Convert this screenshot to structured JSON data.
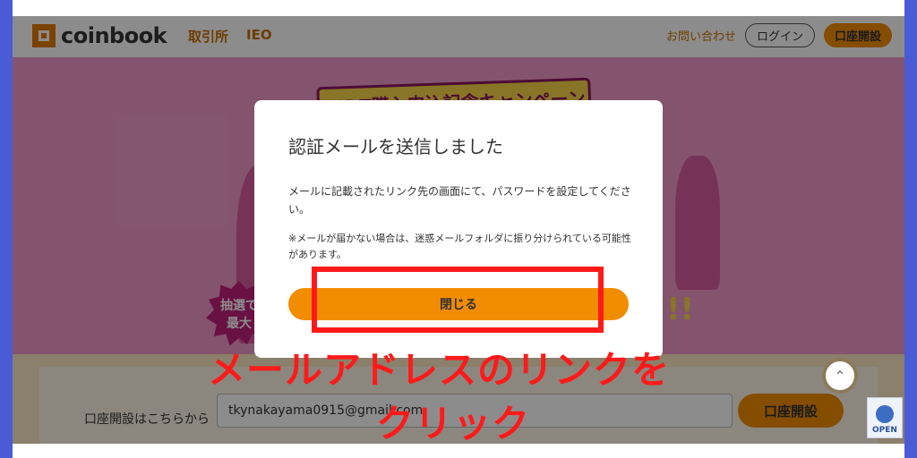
{
  "header": {
    "logo_text": "coinbook",
    "nav": [
      "取引所",
      "IEO"
    ],
    "contact_label": "お問い合わせ",
    "login_label": "ログイン",
    "open_account_label": "口座開設"
  },
  "hero": {
    "campaign_title": "NIDT購入申込記念キャンペーン",
    "burst_line1": "抽選で",
    "burst_line2": "最大",
    "exclaim": "!!"
  },
  "signup": {
    "label": "口座開設はこちらから",
    "email_value": "tkynakayama0915@gmail.com",
    "button_label": "口座開設"
  },
  "badge": {
    "text": "OPEN"
  },
  "modal": {
    "title": "認証メールを送信しました",
    "body": "メールに記載されたリンク先の画面にて、パスワードを設定してください。",
    "note": "※メールが届かない場合は、迷惑メールフォルダに振り分けられている可能性があります。",
    "close_label": "閉じる"
  },
  "annotation": {
    "line1": "メールアドレスのリンクを",
    "line2": "クリック",
    "color": "#ff1a1a"
  },
  "colors": {
    "accent": "#f28c00",
    "hero_bg": "#f19ac9",
    "frame": "#4a5bd6"
  }
}
